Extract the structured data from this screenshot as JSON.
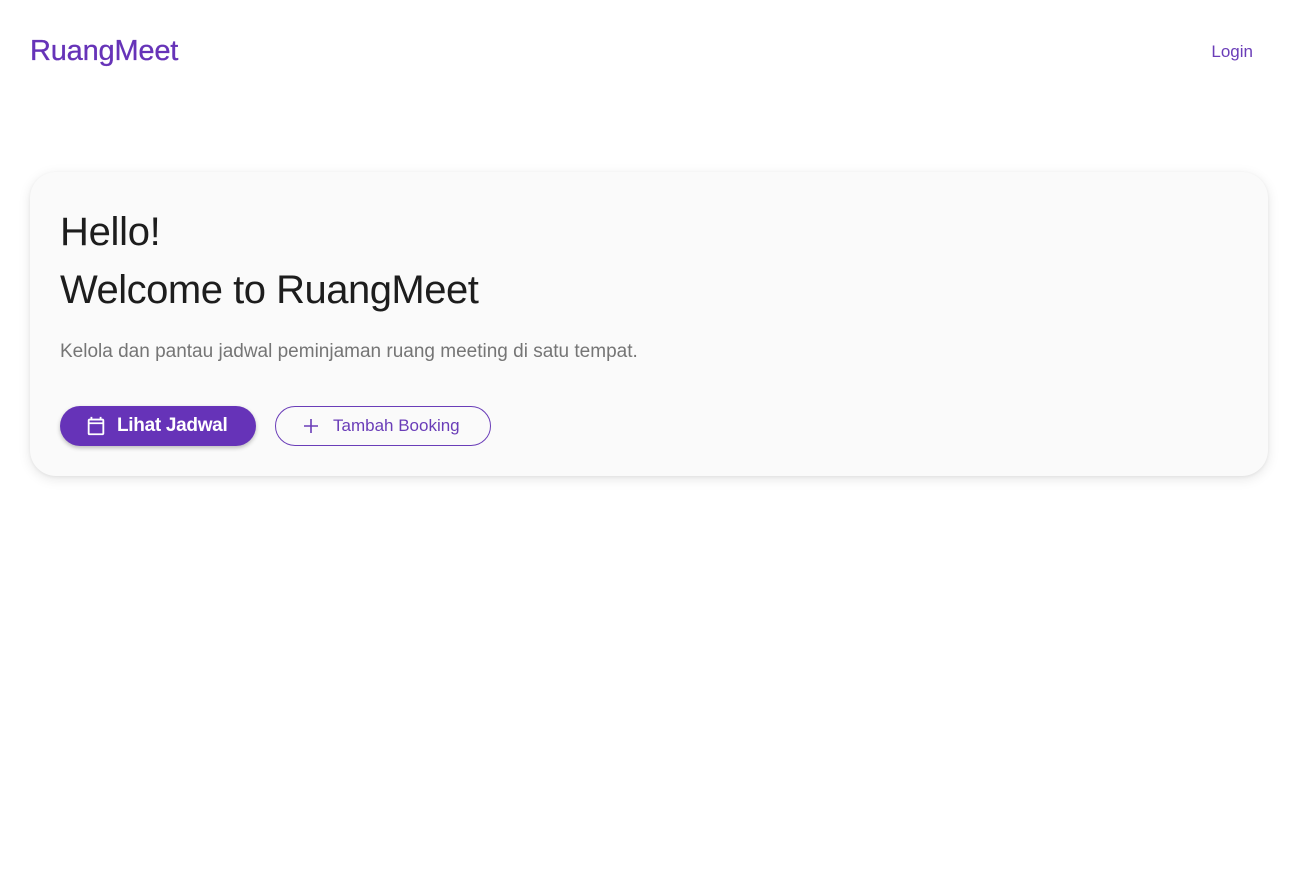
{
  "header": {
    "brand": "RuangMeet",
    "login_label": "Login"
  },
  "hero": {
    "greeting": "Hello!",
    "title": "Welcome to RuangMeet",
    "subtitle": "Kelola dan pantau jadwal peminjaman ruang meeting di satu tempat."
  },
  "actions": {
    "primary": {
      "label": "Lihat Jadwal",
      "icon": "calendar-icon"
    },
    "secondary": {
      "label": "Tambah Booking",
      "icon": "plus-icon"
    }
  },
  "colors": {
    "accent": "#6633b8",
    "card_background": "#fafafa",
    "heading_text": "#1d1d1d",
    "muted_text": "#757575"
  }
}
